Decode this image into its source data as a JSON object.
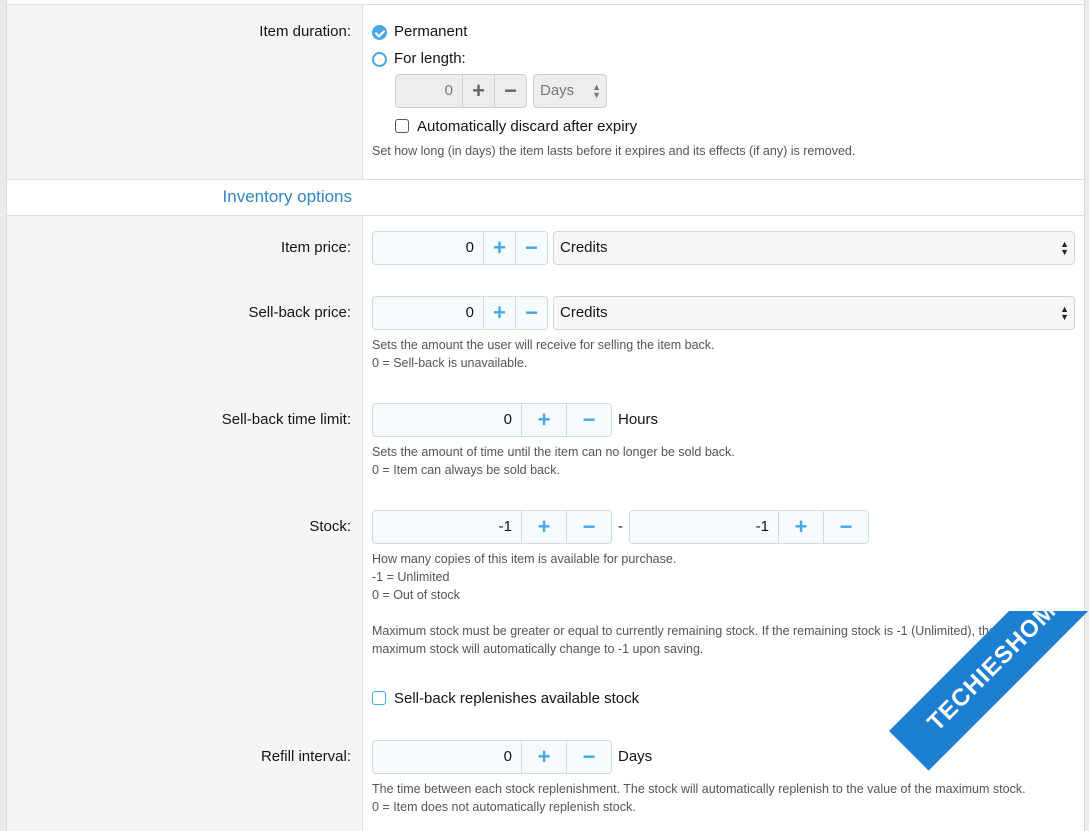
{
  "duration": {
    "label": "Item duration:",
    "permanent_label": "Permanent",
    "for_length_label": "For length:",
    "length_value": "0",
    "unit": "Days",
    "auto_discard_label": "Automatically discard after expiry",
    "hint": "Set how long (in days) the item lasts before it expires and its effects (if any) is removed."
  },
  "section": {
    "title": "Inventory options"
  },
  "price": {
    "label": "Item price:",
    "value": "0",
    "currency": "Credits"
  },
  "sellback": {
    "label": "Sell-back price:",
    "value": "0",
    "currency": "Credits",
    "hint1": "Sets the amount the user will receive for selling the item back.",
    "hint2": "0 = Sell-back is unavailable."
  },
  "timelimit": {
    "label": "Sell-back time limit:",
    "value": "0",
    "unit": "Hours",
    "hint1": "Sets the amount of time until the item can no longer be sold back.",
    "hint2": "0 = Item can always be sold back."
  },
  "stock": {
    "label": "Stock:",
    "value_min": "-1",
    "separator": "-",
    "value_max": "-1",
    "hint1": "How many copies of this item is available for purchase.",
    "hint2": "-1 = Unlimited",
    "hint3": "0 = Out of stock",
    "hint4": "Maximum stock must be greater or equal to currently remaining stock. If the remaining stock is -1 (Unlimited), the",
    "hint5": "maximum stock will automatically change to -1 upon saving.",
    "replenish_label": "Sell-back replenishes available stock"
  },
  "refill": {
    "label": "Refill interval:",
    "value": "0",
    "unit": "Days",
    "hint1": "The time between each stock replenishment. The stock will automatically replenish to the value of the maximum stock.",
    "hint2": "0 = Item does not automatically replenish stock."
  },
  "buttons": {
    "plus": "+",
    "minus": "−"
  },
  "watermark": "TECHIESHOME.COM",
  "colors": {
    "accent": "#47a7eb",
    "section": "#2f86c7"
  }
}
